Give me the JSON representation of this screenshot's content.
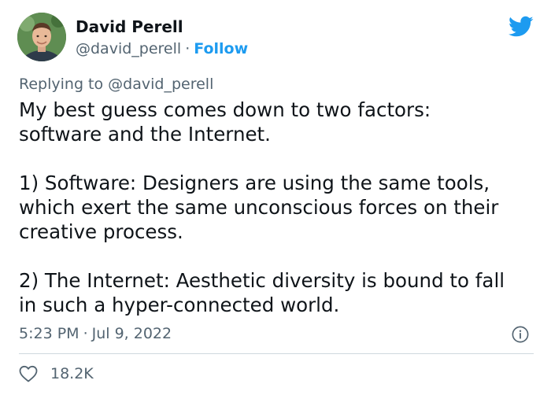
{
  "author": {
    "name": "David Perell",
    "handle": "@david_perell",
    "separator": "·",
    "follow_label": "Follow"
  },
  "reply": {
    "prefix": "Replying to",
    "mention": "@david_perell"
  },
  "tweet": {
    "lines": [
      "My best guess comes down to two factors:",
      "software and the Internet.",
      "",
      "1) Software: Designers are using the same tools,",
      "which exert the same unconscious forces on their",
      "creative process.",
      "",
      "2) The Internet: Aesthetic diversity is bound to fall",
      "in such a hyper-connected world."
    ]
  },
  "meta": {
    "time": "5:23 PM",
    "separator": "·",
    "date": "Jul 9, 2022"
  },
  "engagement": {
    "likes": "18.2K"
  },
  "colors": {
    "accent": "#1d9bf0",
    "secondary_text": "#536471",
    "primary_text": "#0f1419",
    "divider": "#cfd9de"
  },
  "icons": {
    "brand": "twitter-bird-icon",
    "info": "info-icon",
    "like": "heart-icon"
  }
}
